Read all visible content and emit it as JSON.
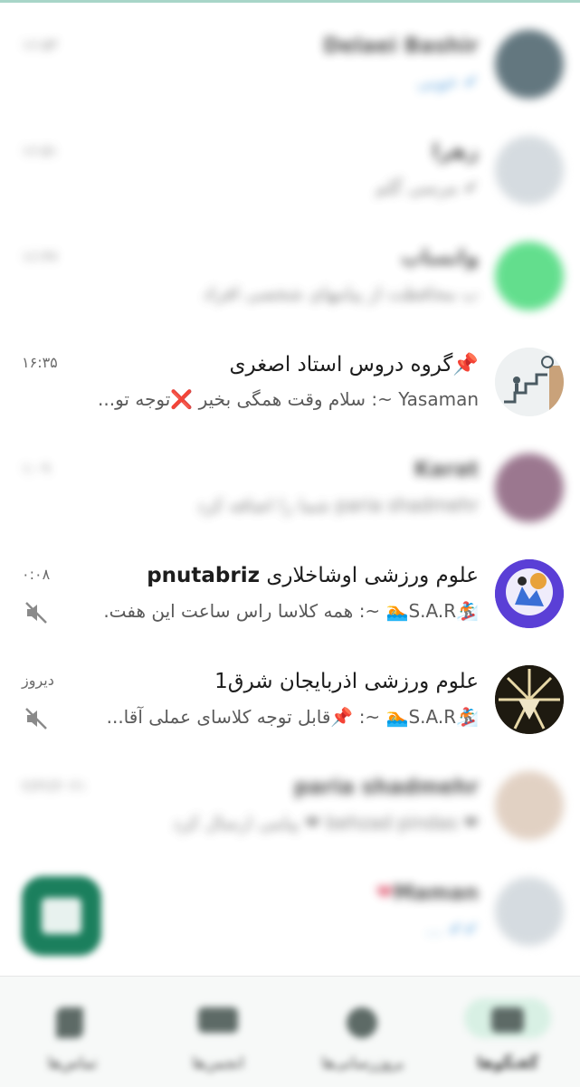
{
  "chats": [
    {
      "name": "Delaei Bashir",
      "preview": "✔ خوبی",
      "time": "۱۶:۵۳",
      "blurred": true,
      "avatar_color": "#2f4a55"
    },
    {
      "name": "زهرا",
      "preview": "✔ مرسی گلم",
      "time": "۱۶:۵۱",
      "blurred": true,
      "avatar_color": "#c8d0d6"
    },
    {
      "name": "واتساپ",
      "preview": "ب محافظت از پیامهای شخصی افراد",
      "time": "۱۶:۴۷",
      "blurred": true,
      "avatar_color": "#2fd468"
    },
    {
      "name": "گروه دروس استاد اصغری",
      "name_prefix": "📌",
      "preview_sender": "Yasaman ~:",
      "preview": "سلام وقت همگی بخیر",
      "preview_suffix": "❌توجه تو...",
      "time": "۱۶:۳۵",
      "blurred": false,
      "muted": false,
      "avatar_color": "#6f7a80"
    },
    {
      "name": "Karat",
      "preview": "paria shadmehr شما را اضافه کرد",
      "time": "۱:۰۹",
      "blurred": true,
      "avatar_color": "#7a4a6a"
    },
    {
      "name": "علوم ورزشی اوشاخلاری",
      "name_bold": "pnutabriz",
      "preview_sender": "🏂S.A.R🏊 ~:",
      "preview": "همه کلاسا راس ساعت این هفت.",
      "time": "۰:۰۸",
      "blurred": false,
      "muted": true,
      "avatar_color": "#5a3fd6"
    },
    {
      "name": "علوم ورزشی اذربایجان شرق1",
      "preview_sender": "🏂S.A.R🏊 ~:",
      "preview": "📌قابل توجه کلاسای عملی آقا...",
      "time": "دیروز",
      "blurred": false,
      "muted": true,
      "avatar_color": "#2a2416"
    },
    {
      "name": "paria shadmehr",
      "preview": "❤ behzad pindas  ❤ پیامی ارسال کرد",
      "time": "۲/۲۲/۲۰۲۱",
      "blurred": true,
      "avatar_color": "#d8c2b0"
    },
    {
      "name": "Maman",
      "name_suffix": "❤",
      "preview": "✔✔ ...",
      "time": "",
      "blurred": true,
      "avatar_color": "#c8d0d6"
    }
  ],
  "nav": [
    {
      "label": "گفتگوها",
      "icon": "chat-icon",
      "active": true
    },
    {
      "label": "بروزرسانی‌ها",
      "icon": "status-icon",
      "active": false
    },
    {
      "label": "انجمن‌ها",
      "icon": "community-icon",
      "active": false
    },
    {
      "label": "تماس‌ها",
      "icon": "call-icon",
      "active": false
    }
  ],
  "fab": {
    "icon": "new-chat-icon"
  },
  "colors": {
    "accent": "#1b7f5d",
    "active_pill": "#d8f0e4"
  }
}
